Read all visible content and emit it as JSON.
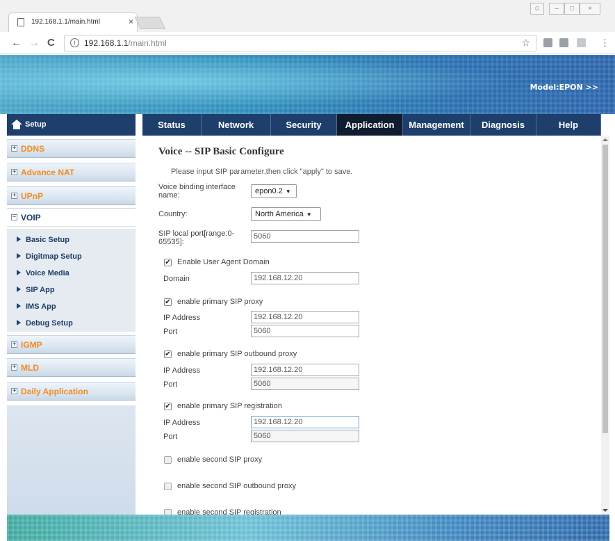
{
  "browser": {
    "tab_title": "192.168.1.1/main.html",
    "tab_close": "×",
    "url_host": "192.168.1.1",
    "url_path": "/main.html",
    "info_icon": "i",
    "star_icon": "☆",
    "menu_icon": "⋮",
    "window_controls": [
      "user-icon",
      "minimize-icon",
      "maximize-icon",
      "close-icon"
    ]
  },
  "header": {
    "model": "Model:EPON >>"
  },
  "menu": {
    "setup_label": "Setup",
    "tabs": [
      {
        "label": "Status"
      },
      {
        "label": "Network"
      },
      {
        "label": "Security"
      },
      {
        "label": "Application",
        "active": true
      },
      {
        "label": "Management"
      },
      {
        "label": "Diagnosis"
      },
      {
        "label": "Help"
      }
    ]
  },
  "sidebar": {
    "groups": [
      {
        "label": "DDNS",
        "toggle": "+"
      },
      {
        "label": "Advance NAT",
        "toggle": "+"
      },
      {
        "label": "UPnP",
        "toggle": "+"
      },
      {
        "label": "VOIP",
        "toggle": "−",
        "expanded": true
      },
      {
        "label": "IGMP",
        "toggle": "+"
      },
      {
        "label": "MLD",
        "toggle": "+"
      },
      {
        "label": "Daily Application",
        "toggle": "+"
      }
    ],
    "voip_items": [
      {
        "label": "Basic Setup"
      },
      {
        "label": "Digitmap Setup"
      },
      {
        "label": "Voice Media"
      },
      {
        "label": "SIP App"
      },
      {
        "label": "IMS App"
      },
      {
        "label": "Debug Setup"
      }
    ]
  },
  "form": {
    "title": "Voice -- SIP Basic Configure",
    "hint": "Please input SIP parameter,then click \"apply\" to save.",
    "voice_binding_label_1": "Voice binding interface",
    "voice_binding_label_2": "name:",
    "voice_binding_value": "epon0.2",
    "country_label": "Country:",
    "country_value": "North America",
    "sip_local_port_label_1": "SIP local port[range:0-",
    "sip_local_port_label_2": "65535]:",
    "sip_local_port_value": "5060",
    "uad": {
      "label": "Enable User Agent Domain",
      "checked": true,
      "domain_label": "Domain",
      "domain_value": "192.168.12.20"
    },
    "primary_proxy": {
      "label": "enable primary SIP proxy",
      "checked": true,
      "ip_label": "IP Address",
      "ip_value": "192.168.12.20",
      "port_label": "Port",
      "port_value": "5060"
    },
    "primary_outbound": {
      "label": "enable primary SIP outbound proxy",
      "checked": true,
      "ip_label": "IP Address",
      "ip_value": "192.168.12.20",
      "port_label": "Port",
      "port_value": "5060"
    },
    "primary_registration": {
      "label": "enable primary SIP registration",
      "checked": true,
      "ip_label": "IP Address",
      "ip_value": "192.168.12.20",
      "port_label": "Port",
      "port_value": "5060"
    },
    "second_proxy": {
      "label": "enable second SIP proxy",
      "checked": false
    },
    "second_outbound": {
      "label": "enable second SIP outbound proxy",
      "checked": false
    },
    "second_registration": {
      "label": "enable second SIP registration",
      "checked": false
    }
  },
  "colors": {
    "nav_bg": "#1e3f6c",
    "nav_active": "#101d30",
    "sidebar_label": "#f28b1f"
  }
}
